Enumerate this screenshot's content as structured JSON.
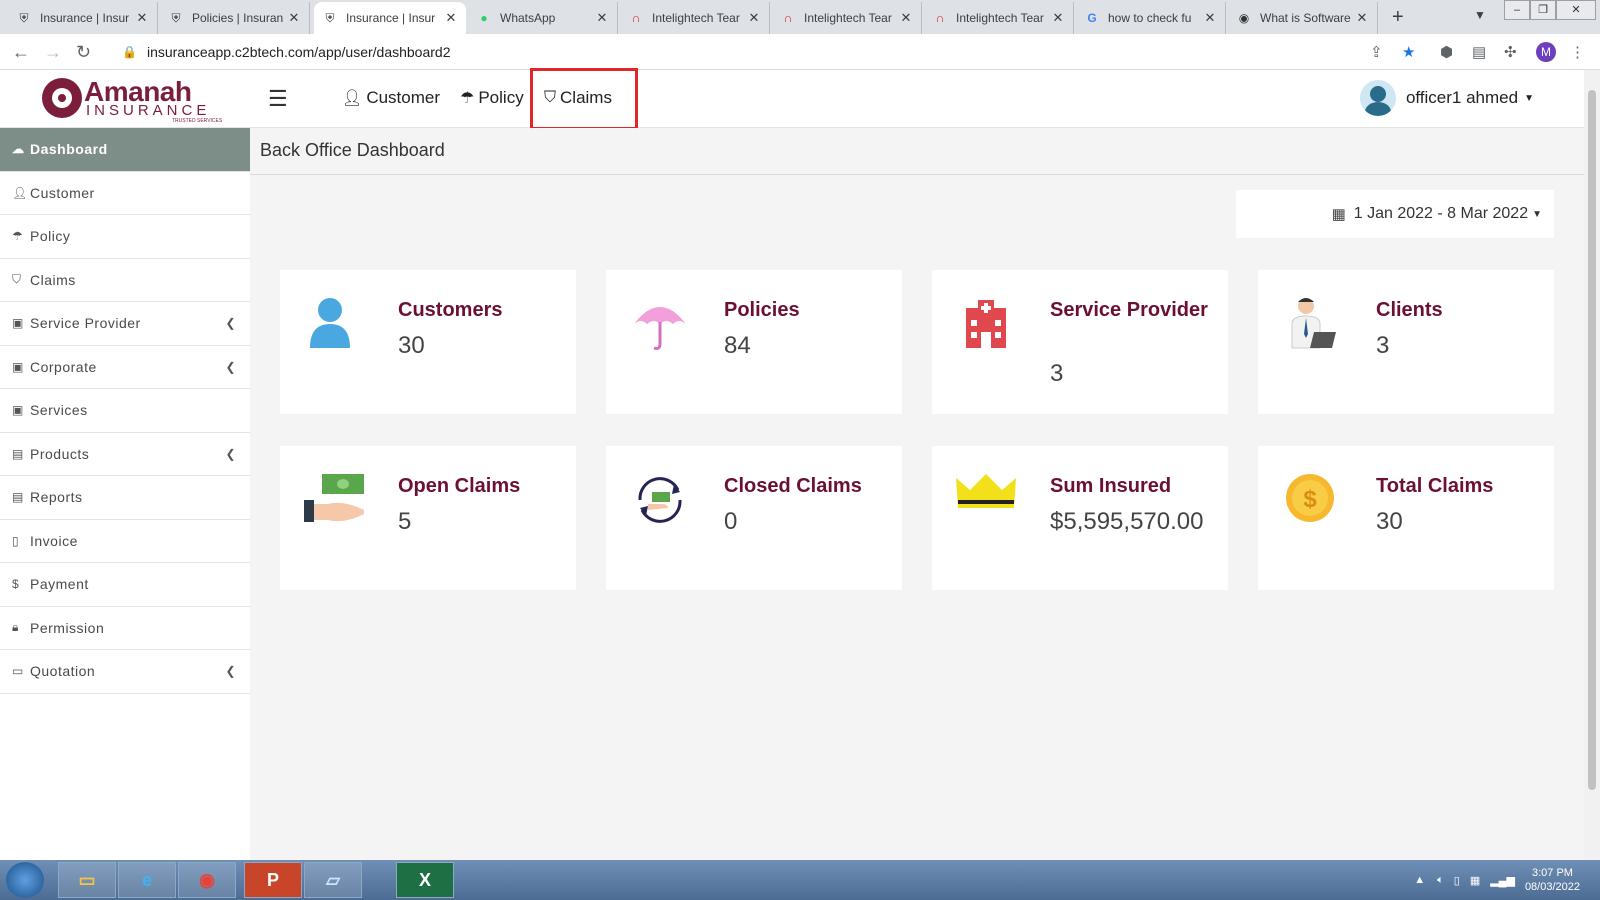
{
  "browser": {
    "tabs": [
      {
        "title": "Insurance | Insur",
        "icon": "shield-icon"
      },
      {
        "title": "Policies | Insuran",
        "icon": "shield-icon"
      },
      {
        "title": "Insurance | Insur",
        "icon": "shield-icon",
        "active": true
      },
      {
        "title": "WhatsApp",
        "icon": "whatsapp-icon"
      },
      {
        "title": "Intelightech Tear",
        "icon": "intelightech-icon"
      },
      {
        "title": "Intelightech Tear",
        "icon": "intelightech-icon"
      },
      {
        "title": "Intelightech Tear",
        "icon": "intelightech-icon"
      },
      {
        "title": "how to check fu",
        "icon": "google-icon"
      },
      {
        "title": "What is Software",
        "icon": "site-icon"
      }
    ],
    "url": "insuranceapp.c2btech.com/app/user/dashboard2",
    "profile_initial": "M"
  },
  "header": {
    "logo_name": "Amanah",
    "logo_sub": "INSURANCE",
    "logo_tag": "TRUSTED SERVICES",
    "nav": {
      "customer": "Customer",
      "policy": "Policy",
      "claims": "Claims"
    },
    "user_name": "officer1 ahmed"
  },
  "sidebar": {
    "items": [
      {
        "label": "Dashboard",
        "icon": "dashboard-icon",
        "active": true
      },
      {
        "label": "Customer",
        "icon": "user-icon"
      },
      {
        "label": "Policy",
        "icon": "umbrella-icon"
      },
      {
        "label": "Claims",
        "icon": "claims-icon"
      },
      {
        "label": "Service Provider",
        "icon": "briefcase-icon",
        "expandable": true
      },
      {
        "label": "Corporate",
        "icon": "briefcase-icon",
        "expandable": true
      },
      {
        "label": "Services",
        "icon": "briefcase-icon"
      },
      {
        "label": "Products",
        "icon": "archive-icon",
        "expandable": true
      },
      {
        "label": "Reports",
        "icon": "archive-icon"
      },
      {
        "label": "Invoice",
        "icon": "file-icon"
      },
      {
        "label": "Payment",
        "icon": "dollar-icon"
      },
      {
        "label": "Permission",
        "icon": "lock-icon"
      },
      {
        "label": "Quotation",
        "icon": "comment-icon",
        "expandable": true
      }
    ]
  },
  "main": {
    "title": "Back Office Dashboard",
    "date_range": "1 Jan 2022 - 8 Mar 2022",
    "cards": [
      {
        "label": "Customers",
        "value": "30",
        "icon": "person-icon"
      },
      {
        "label": "Policies",
        "value": "84",
        "icon": "umbrella-icon"
      },
      {
        "label": "Service Provider",
        "value": "3",
        "icon": "hospital-icon"
      },
      {
        "label": "Clients",
        "value": "3",
        "icon": "businessman-icon"
      },
      {
        "label": "Open Claims",
        "value": "5",
        "icon": "cash-hand-icon"
      },
      {
        "label": "Closed Claims",
        "value": "0",
        "icon": "cash-cycle-icon"
      },
      {
        "label": "Sum Insured",
        "value": "$5,595,570.00",
        "icon": "crown-icon"
      },
      {
        "label": "Total Claims",
        "value": "30",
        "icon": "coin-icon"
      }
    ]
  },
  "taskbar": {
    "time": "3:07 PM",
    "date": "08/03/2022",
    "apps": [
      "explorer-icon",
      "edge-icon",
      "chrome-icon",
      "powerpoint-icon",
      "notepad-icon",
      "excel-icon"
    ]
  },
  "colors": {
    "accent": "#6b1034",
    "sidebar_active": "#7d8e88",
    "highlight_box": "#e0262a"
  }
}
